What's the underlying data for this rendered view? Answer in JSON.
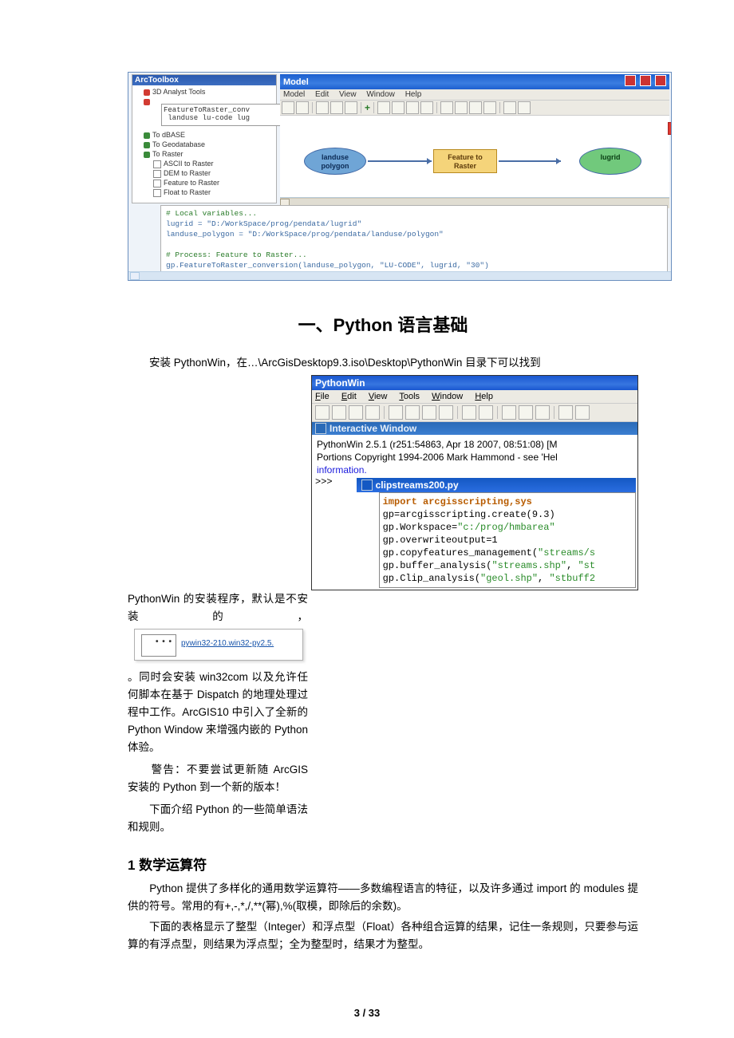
{
  "fig1": {
    "toolbox": {
      "title": "ArcToolbox",
      "items": [
        "3D Analyst Tools",
        "To dBASE",
        "To Geodatabase",
        "To Raster",
        "ASCII to Raster",
        "DEM to Raster",
        "Feature to Raster",
        "Float to Raster"
      ]
    },
    "cmdbox": "FeatureToRaster_conv\n landuse lu-code lug",
    "model": {
      "title": "Model",
      "menus": [
        "Model",
        "Edit",
        "View",
        "Window",
        "Help"
      ],
      "toolbar_plus": "+",
      "ovals": {
        "left": "landuse\npolygon",
        "right": "lugrid"
      },
      "rect": "Feature to\nRaster"
    },
    "code": {
      "l1": "# Local variables...",
      "l2": "lugrid = \"D:/WorkSpace/prog/pendata/lugrid\"",
      "l3": "landuse_polygon = \"D:/WorkSpace/prog/pendata/landuse/polygon\"",
      "l4": "# Process: Feature to Raster...",
      "l5": "gp.FeatureToRaster_conversion(landuse_polygon, \"LU-CODE\", lugrid, \"30\")"
    }
  },
  "sec_title": "一、Python 语言基础",
  "intro_line": "安装 PythonWin，在…\\ArcGisDesktop9.3.iso\\Desktop\\PythonWin 目录下可以找到",
  "left": {
    "p1": "PythonWin 的安装程序，默认是不安装的，",
    "installer_link": "pywin32-210.win32-py2.5.",
    "p2": "。同时会安装 win32com 以及允许任何脚本在基于 Dispatch 的地理处理过程中工作。ArcGIS10 中引入了全新的 Python Window 来增强内嵌的 Python 体验。",
    "warn": "　　警告：不要尝试更新随 ArcGIS 安装的 Python 到一个新的版本！",
    "p3": "　　下面介绍 Python 的一些简单语法和规则。"
  },
  "pywin": {
    "title": "PythonWin",
    "menus": [
      "File",
      "Edit",
      "View",
      "Tools",
      "Window",
      "Help"
    ],
    "interactive_title": "Interactive Window",
    "banner_l1": "PythonWin 2.5.1 (r251:54863, Apr 18 2007, 08:51:08) [M",
    "banner_l2": "Portions Copyright 1994-2006 Mark Hammond - see 'Hel",
    "banner_l3": "information.",
    "prompt": ">>>",
    "editor_title": "clipstreams200.py",
    "code": {
      "l1": "import arcgisscripting,sys",
      "l2": "gp=arcgisscripting.create(9.3)",
      "l3a": "gp.Workspace=",
      "l3b": "\"c:/prog/hmbarea\"",
      "l4": "gp.overwriteoutput=1",
      "l5a": "gp.copyfeatures_management(",
      "l5b": "\"streams/s",
      "l6a": "gp.buffer_analysis(",
      "l6b": "\"streams.shp\"",
      "l6c": ", ",
      "l6d": "\"st",
      "l7a": "gp.Clip_analysis(",
      "l7b": "\"geol.shp\"",
      "l7c": ", ",
      "l7d": "\"stbuff2"
    }
  },
  "h3_math": "1 数学运算符",
  "math_p1": "　　Python 提供了多样化的通用数学运算符——多数编程语言的特征，以及许多通过 import 的 modules 提供的符号。常用的有+,-,*,/,**(幂),%(取模，即除后的余数)。",
  "math_p2": "　　下面的表格显示了整型（Integer）和浮点型（Float）各种组合运算的结果，记住一条规则，只要参与运算的有浮点型，则结果为浮点型；全为整型时，结果才为整型。",
  "page_num": "3 / 33"
}
